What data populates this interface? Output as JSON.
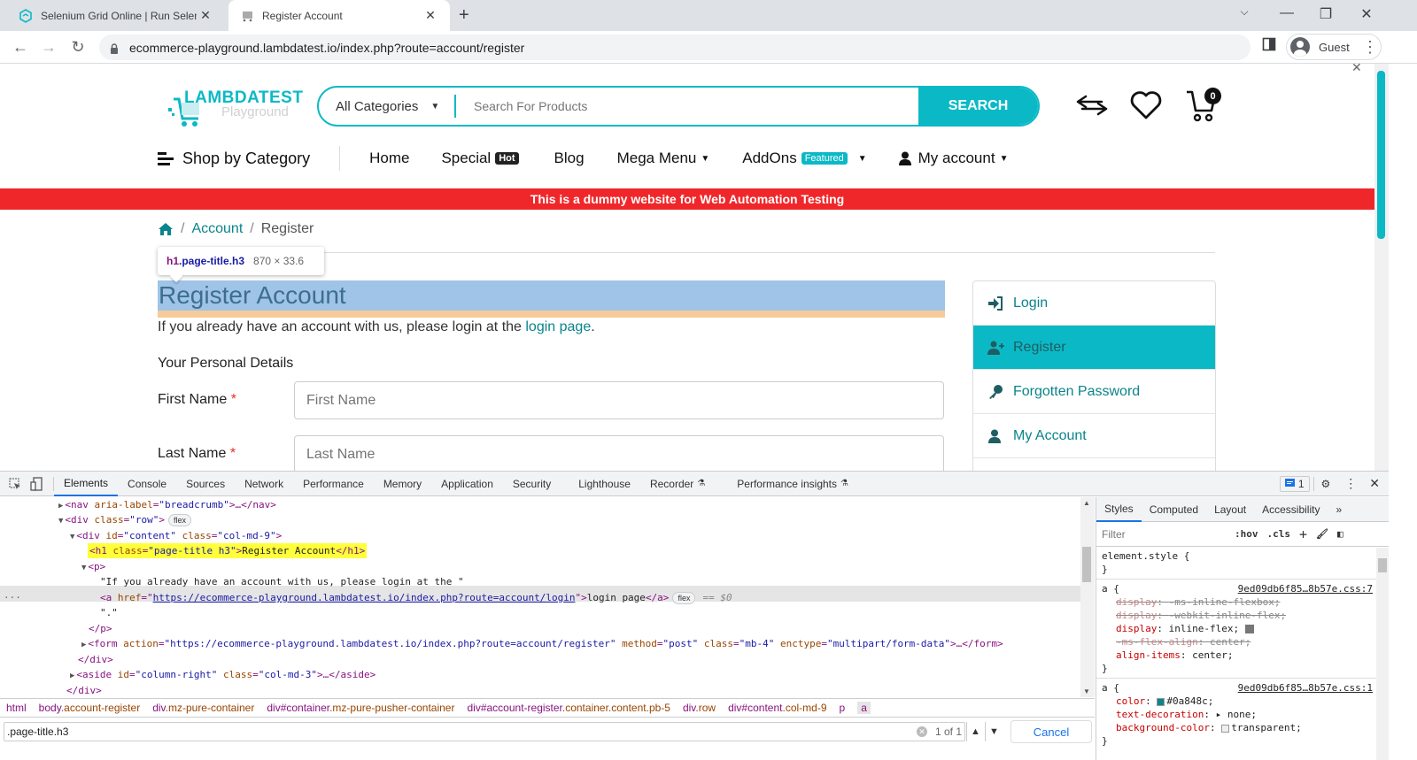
{
  "browser": {
    "tabs": [
      {
        "title": "Selenium Grid Online | Run Selen",
        "icon": "lambdatest-logo-icon",
        "active": false
      },
      {
        "title": "Register Account",
        "icon": "cart-favicon-icon",
        "active": true
      }
    ],
    "new_tab_label": "+",
    "url": "ecommerce-playground.lambdatest.io/index.php?route=account/register",
    "profile_label": "Guest"
  },
  "site": {
    "logo": {
      "line1": "LAMBDATEST",
      "line2": "Playground"
    },
    "search": {
      "category": "All Categories",
      "placeholder": "Search For Products",
      "button": "SEARCH"
    },
    "cart_count": "0",
    "nav": {
      "shop_by_category": "Shop by Category",
      "items": [
        {
          "label": "Home"
        },
        {
          "label": "Special",
          "badge": "Hot"
        },
        {
          "label": "Blog"
        },
        {
          "label": "Mega Menu",
          "caret": true
        },
        {
          "label": "AddOns",
          "badge": "Featured",
          "caret": true
        },
        {
          "label": "My account",
          "caret": true
        }
      ]
    },
    "banner": "This is a dummy website for Web Automation Testing",
    "breadcrumb": [
      {
        "label": "Account"
      },
      {
        "label": "Register"
      }
    ],
    "page_title": "Register Account",
    "intro_text": "If you already have an account with us, please login at the ",
    "intro_link": "login page",
    "intro_end": ".",
    "section_title": "Your Personal Details",
    "fields": [
      {
        "label": "First Name",
        "required": "*",
        "placeholder": "First Name",
        "value": ""
      },
      {
        "label": "Last Name",
        "required": "*",
        "placeholder": "Last Name",
        "value": ""
      }
    ],
    "sidebar": [
      {
        "label": "Login",
        "icon": "sign-in-icon",
        "active": false
      },
      {
        "label": "Register",
        "icon": "user-plus-icon",
        "active": true
      },
      {
        "label": "Forgotten Password",
        "icon": "key-icon",
        "active": false
      },
      {
        "label": "My Account",
        "icon": "user-icon",
        "active": false
      }
    ]
  },
  "inspector_tooltip": {
    "selector_tag": "h1",
    "selector_class": ".page-title.h3",
    "size": "870 × 33.6"
  },
  "devtools": {
    "tabs": [
      "Elements",
      "Console",
      "Sources",
      "Network",
      "Performance",
      "Memory",
      "Application",
      "Security",
      "Lighthouse",
      "Recorder",
      "Performance insights"
    ],
    "active_tab": "Elements",
    "issues_count": "1",
    "dom_lines": {
      "l1": {
        "open": "<nav ",
        "attr": "aria-label",
        "val": "\"breadcrumb\"",
        "close": ">…</nav>"
      },
      "l2": {
        "open": "<div ",
        "attr": "class",
        "val": "\"row\"",
        "close": ">",
        "pill": "flex"
      },
      "l3": {
        "open": "<div ",
        "attr1": "id",
        "val1": "\"content\"",
        "attr2": "class",
        "val2": "\"col-md-9\"",
        "close": ">"
      },
      "l4": {
        "open": "<h1 ",
        "attr": "class",
        "val": "\"page-title h3\"",
        "text": "Register Account",
        "close": "</h1>"
      },
      "l5": {
        "open": "<p>"
      },
      "l6": {
        "text": "\"If you already have an account with us, please login at the \""
      },
      "l7": {
        "open": "<a ",
        "attr": "href",
        "val": "https://ecommerce-playground.lambdatest.io/index.php?route=account/login",
        "text": "login page",
        "close": "</a>",
        "pill": "flex",
        "eq": "== $0"
      },
      "l8": {
        "text": "\".\""
      },
      "l9": {
        "close": "</p>"
      },
      "l10": {
        "open": "<form ",
        "attr1": "action",
        "val1": "\"https://ecommerce-playground.lambdatest.io/index.php?route=account/register\"",
        "attr2": "method",
        "val2": "\"post\"",
        "attr3": "class",
        "val3": "\"mb-4\"",
        "attr4": "enctype",
        "val4": "\"multipart/form-data\"",
        "close": ">…</form>"
      },
      "l11": {
        "close": "</div>"
      },
      "l12": {
        "open": "<aside ",
        "attr1": "id",
        "val1": "\"column-right\"",
        "attr2": "class",
        "val2": "\"col-md-3\"",
        "close": ">…</aside>"
      },
      "l13": {
        "close": "</div>"
      }
    },
    "breadcrumbs": [
      {
        "tag": "html",
        "cls": ""
      },
      {
        "tag": "body",
        "cls": ".account-register"
      },
      {
        "tag": "div",
        "cls": ".mz-pure-container"
      },
      {
        "tag": "div#container",
        "cls": ".mz-pure-pusher-container"
      },
      {
        "tag": "div#account-register",
        "cls": ".container.content.pb-5"
      },
      {
        "tag": "div",
        "cls": ".row"
      },
      {
        "tag": "div#content",
        "cls": ".col-md-9"
      },
      {
        "tag": "p",
        "cls": ""
      },
      {
        "tag": "a",
        "cls": ""
      }
    ],
    "find": {
      "query": ".page-title.h3",
      "count": "1 of 1",
      "cancel": "Cancel"
    },
    "styles": {
      "tabs": [
        "Styles",
        "Computed",
        "Layout",
        "Accessibility",
        "»"
      ],
      "filter_placeholder": "Filter",
      "hov": ":hov",
      "cls": ".cls",
      "element_style": "element.style {",
      "rule1": {
        "selector": "a {",
        "source": "9ed09db6f85…8b57e.css:7",
        "props": [
          {
            "name": "display",
            "value": "-ms-inline-flexbox;",
            "struck": true
          },
          {
            "name": "display",
            "value": "-webkit-inline-flex;",
            "struck": true
          },
          {
            "name": "display",
            "value": "inline-flex;",
            "struck": false
          },
          {
            "name": "-ms-flex-align",
            "value": "center;",
            "struck": true
          },
          {
            "name": "align-items",
            "value": "center;",
            "struck": false
          }
        ]
      },
      "rule2": {
        "selector": "a {",
        "source": "9ed09db6f85…8b57e.css:1",
        "props": [
          {
            "name": "color",
            "value": "#0a848c;",
            "swatch": "#0a848c"
          },
          {
            "name": "text-decoration",
            "value": "▸ none;"
          },
          {
            "name": "background-color",
            "value": "transparent;",
            "swatch": "#ffffff"
          }
        ]
      }
    }
  },
  "colors": {
    "brand_teal": "#0bb9c6",
    "link": "#0a848c",
    "banner_red": "#f0272a"
  }
}
